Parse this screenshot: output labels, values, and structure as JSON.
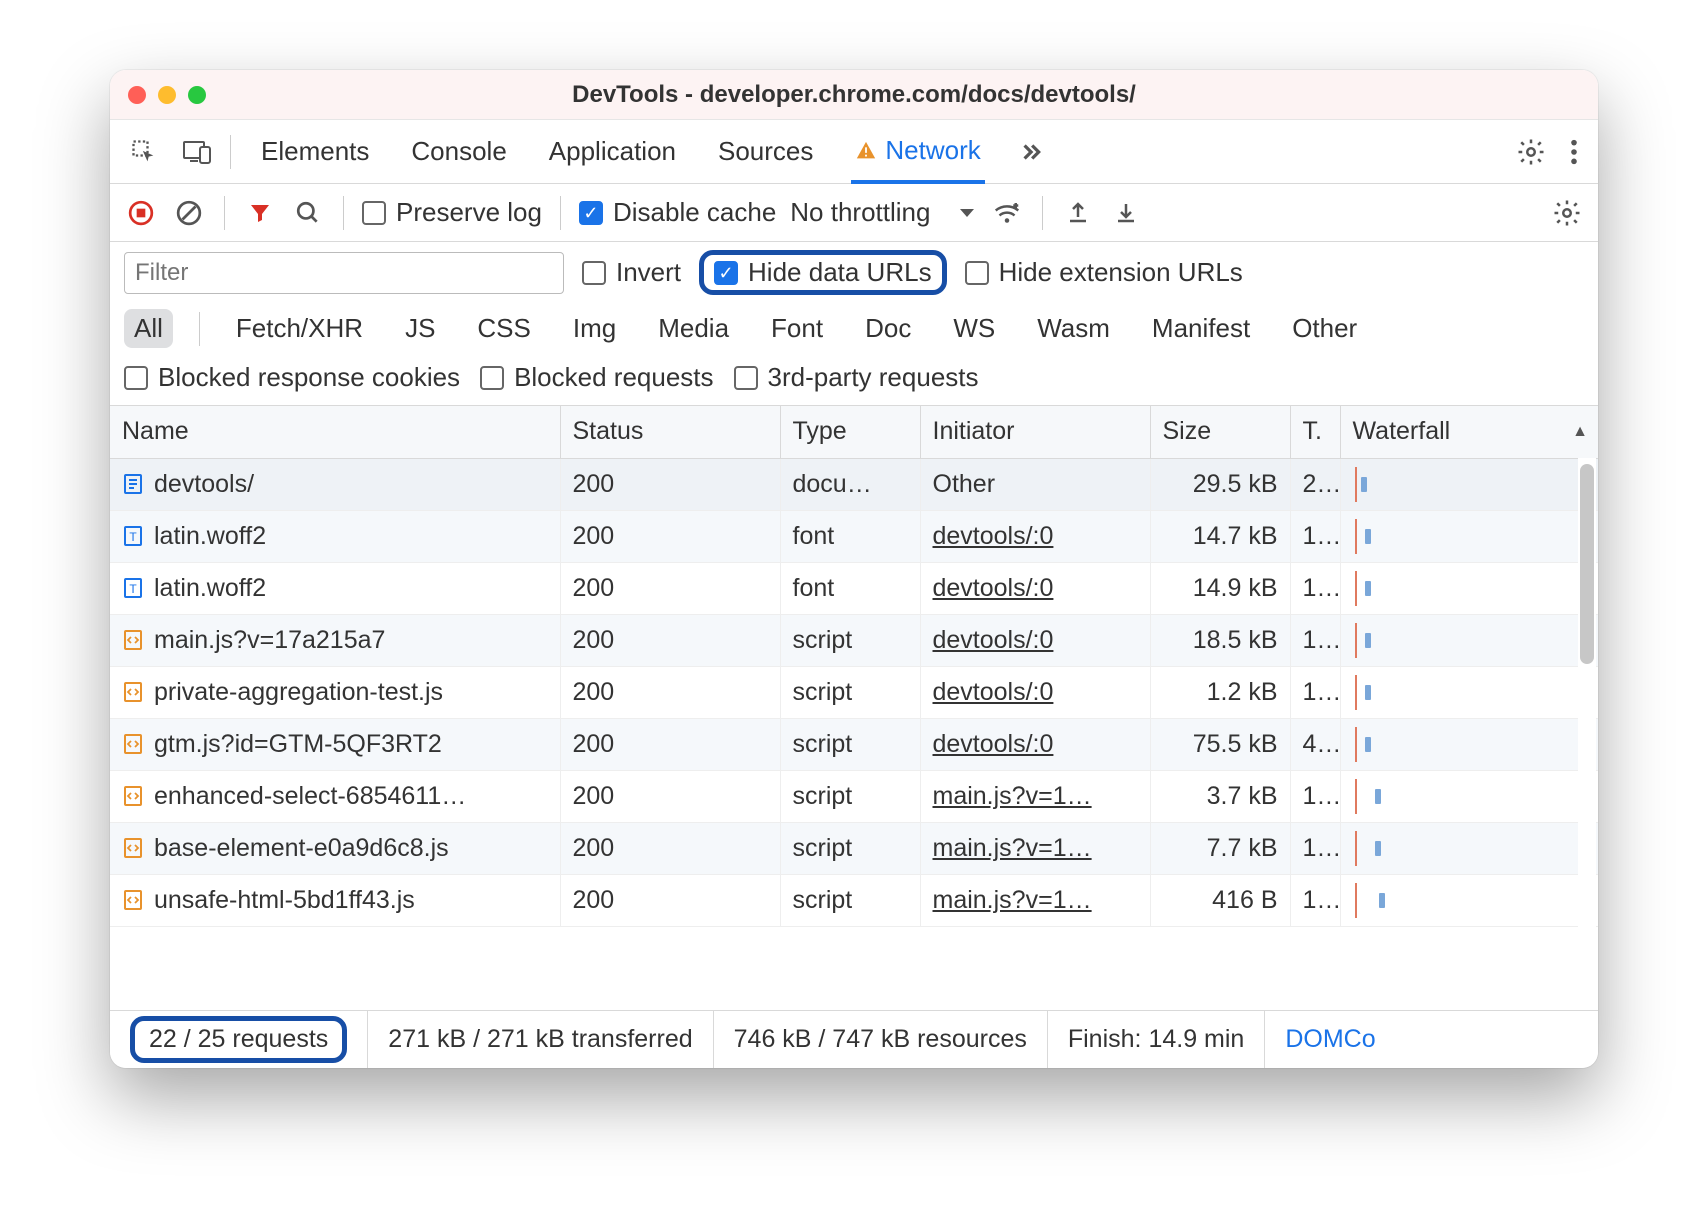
{
  "window": {
    "title": "DevTools - developer.chrome.com/docs/devtools/"
  },
  "tabs": {
    "items": [
      "Elements",
      "Console",
      "Application",
      "Sources",
      "Network"
    ],
    "active": "Network",
    "warning_on": "Network"
  },
  "toolbar": {
    "preserve_log": {
      "label": "Preserve log",
      "checked": false
    },
    "disable_cache": {
      "label": "Disable cache",
      "checked": true
    },
    "throttling": {
      "label": "No throttling"
    }
  },
  "filters": {
    "filter_placeholder": "Filter",
    "invert": {
      "label": "Invert",
      "checked": false
    },
    "hide_data_urls": {
      "label": "Hide data URLs",
      "checked": true
    },
    "hide_ext_urls": {
      "label": "Hide extension URLs",
      "checked": false
    },
    "types": [
      "All",
      "Fetch/XHR",
      "JS",
      "CSS",
      "Img",
      "Media",
      "Font",
      "Doc",
      "WS",
      "Wasm",
      "Manifest",
      "Other"
    ],
    "type_active": "All",
    "blocked_response_cookies": {
      "label": "Blocked response cookies",
      "checked": false
    },
    "blocked_requests": {
      "label": "Blocked requests",
      "checked": false
    },
    "third_party": {
      "label": "3rd-party requests",
      "checked": false
    }
  },
  "columns": [
    "Name",
    "Status",
    "Type",
    "Initiator",
    "Size",
    "T.",
    "Waterfall"
  ],
  "rows": [
    {
      "icon": "doc",
      "color": "#1a73e8",
      "name": "devtools/",
      "status": "200",
      "type": "docu…",
      "initiator": "Other",
      "initiator_link": false,
      "size": "29.5 kB",
      "time": "2..",
      "wf": 0,
      "selected": true
    },
    {
      "icon": "font",
      "color": "#1a73e8",
      "name": "latin.woff2",
      "status": "200",
      "type": "font",
      "initiator": "devtools/:0",
      "initiator_link": true,
      "size": "14.7 kB",
      "time": "1..",
      "wf": 4
    },
    {
      "icon": "font",
      "color": "#1a73e8",
      "name": "latin.woff2",
      "status": "200",
      "type": "font",
      "initiator": "devtools/:0",
      "initiator_link": true,
      "size": "14.9 kB",
      "time": "1..",
      "wf": 4
    },
    {
      "icon": "js",
      "color": "#e8922c",
      "name": "main.js?v=17a215a7",
      "status": "200",
      "type": "script",
      "initiator": "devtools/:0",
      "initiator_link": true,
      "size": "18.5 kB",
      "time": "1..",
      "wf": 4
    },
    {
      "icon": "js",
      "color": "#e8922c",
      "name": "private-aggregation-test.js",
      "status": "200",
      "type": "script",
      "initiator": "devtools/:0",
      "initiator_link": true,
      "size": "1.2 kB",
      "time": "1..",
      "wf": 4
    },
    {
      "icon": "js",
      "color": "#e8922c",
      "name": "gtm.js?id=GTM-5QF3RT2",
      "status": "200",
      "type": "script",
      "initiator": "devtools/:0",
      "initiator_link": true,
      "size": "75.5 kB",
      "time": "4..",
      "wf": 4
    },
    {
      "icon": "js",
      "color": "#e8922c",
      "name": "enhanced-select-6854611…",
      "status": "200",
      "type": "script",
      "initiator": "main.js?v=1…",
      "initiator_link": true,
      "size": "3.7 kB",
      "time": "1..",
      "wf": 14
    },
    {
      "icon": "js",
      "color": "#e8922c",
      "name": "base-element-e0a9d6c8.js",
      "status": "200",
      "type": "script",
      "initiator": "main.js?v=1…",
      "initiator_link": true,
      "size": "7.7 kB",
      "time": "1..",
      "wf": 14
    },
    {
      "icon": "js",
      "color": "#e8922c",
      "name": "unsafe-html-5bd1ff43.js",
      "status": "200",
      "type": "script",
      "initiator": "main.js?v=1…",
      "initiator_link": true,
      "size": "416 B",
      "time": "1..",
      "wf": 18
    }
  ],
  "status": {
    "requests": "22 / 25 requests",
    "transferred": "271 kB / 271 kB transferred",
    "resources": "746 kB / 747 kB resources",
    "finish": "Finish: 14.9 min",
    "domcontent": "DOMCo"
  }
}
